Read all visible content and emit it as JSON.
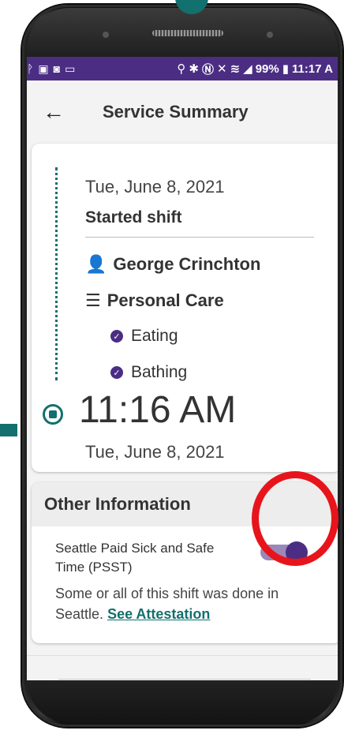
{
  "status_bar": {
    "left_icons": [
      "pin-icon",
      "image-icon",
      "app-icon",
      "screen-icon"
    ],
    "right_text": "99%",
    "time": "11:17 A"
  },
  "header": {
    "title": "Service Summary"
  },
  "timeline": {
    "start_date": "Tue, June 8, 2021",
    "event": "Started shift",
    "client": "George Crinchton",
    "service": "Personal Care",
    "tasks": [
      "Eating",
      "Bathing"
    ],
    "end_time": "11:16 AM",
    "end_date": "Tue, June 8, 2021"
  },
  "other_info": {
    "heading": "Other Information",
    "pssT_label": "Seattle Paid Sick and Safe Time (PSST)",
    "toggle_on": true,
    "note_text": "Some or all of this shift was done in Seattle.",
    "link_text": "See Attestation"
  },
  "colors": {
    "brand_purple": "#4b2e83",
    "teal": "#12706e",
    "highlight_red": "#e8141b"
  }
}
